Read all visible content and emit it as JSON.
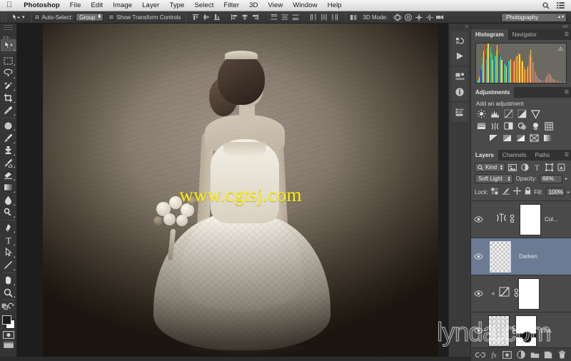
{
  "menubar": {
    "apple_icon": "apple-logo-icon",
    "items": [
      "Photoshop",
      "File",
      "Edit",
      "Image",
      "Layer",
      "Type",
      "Select",
      "Filter",
      "3D",
      "View",
      "Window",
      "Help"
    ],
    "right_icons": [
      "search-icon",
      "list-menu-icon"
    ]
  },
  "options_bar": {
    "tool_icon": "move-tool-icon",
    "auto_select_label": "Auto-Select:",
    "auto_select_value": "Group",
    "show_transform_label": "Show Transform Controls",
    "three_d_mode_label": "3D Mode:",
    "workspace_value": "Photography"
  },
  "toolbox": {
    "tools": [
      {
        "name": "move-tool",
        "selected": true
      },
      {
        "name": "rectangular-marquee-tool",
        "selected": false
      },
      {
        "name": "lasso-tool",
        "selected": false
      },
      {
        "name": "quick-selection-tool",
        "selected": false
      },
      {
        "name": "crop-tool",
        "selected": false
      },
      {
        "name": "eyedropper-tool",
        "selected": false
      },
      {
        "name": "spot-healing-brush-tool",
        "selected": false
      },
      {
        "name": "brush-tool",
        "selected": false
      },
      {
        "name": "clone-stamp-tool",
        "selected": false
      },
      {
        "name": "history-brush-tool",
        "selected": false
      },
      {
        "name": "eraser-tool",
        "selected": false
      },
      {
        "name": "gradient-tool",
        "selected": false
      },
      {
        "name": "blur-tool",
        "selected": false
      },
      {
        "name": "dodge-tool",
        "selected": false
      },
      {
        "name": "pen-tool",
        "selected": false
      },
      {
        "name": "horizontal-type-tool",
        "selected": false
      },
      {
        "name": "path-selection-tool",
        "selected": false
      },
      {
        "name": "line-shape-tool",
        "selected": false
      },
      {
        "name": "hand-tool",
        "selected": false
      },
      {
        "name": "zoom-tool",
        "selected": false
      }
    ],
    "foreground_color": "#1b1b1b",
    "background_color": "#ffffff",
    "quick_mask_name": "quick-mask-mode",
    "screen_mode_name": "screen-mode"
  },
  "canvas": {
    "watermark": "www.cgtsj.com",
    "watermark_color": "#ffee14",
    "image_description": "bride-portrait"
  },
  "mini_dock": {
    "buttons": [
      "history-panel-icon",
      "actions-play-icon",
      "properties-panel-icon",
      "info-panel-icon",
      "layer-comps-icon"
    ]
  },
  "panels": {
    "histogram": {
      "tabs": [
        {
          "label": "Histogram",
          "active": true
        },
        {
          "label": "Navigator",
          "active": false
        }
      ],
      "warning_icon": "cached-data-warning-icon",
      "bins": [
        3,
        5,
        8,
        14,
        22,
        31,
        46,
        62,
        78,
        92,
        70,
        55,
        84,
        96,
        74,
        61,
        88,
        72,
        55,
        40,
        52,
        66,
        79,
        93,
        88,
        70,
        58,
        64,
        56,
        49,
        53,
        47,
        44,
        40,
        44,
        49,
        52,
        55,
        58,
        56,
        53,
        50,
        54,
        58,
        62,
        66,
        71,
        75,
        70,
        64,
        58,
        52,
        46,
        40,
        34,
        29,
        33,
        41,
        55,
        68,
        80,
        74,
        62,
        50,
        38,
        30,
        24,
        18,
        14,
        11,
        9,
        7,
        6,
        5,
        5,
        6,
        8,
        11,
        16,
        22,
        28,
        24,
        19,
        15,
        12,
        10,
        8,
        7,
        6,
        5,
        4,
        4,
        3,
        3,
        2,
        2,
        2,
        1,
        1,
        1
      ]
    },
    "adjustments": {
      "tabs": [
        {
          "label": "Adjustments",
          "active": true
        }
      ],
      "title": "Add an adjustment",
      "row1": [
        "brightness-contrast-icon",
        "levels-icon",
        "curves-icon",
        "exposure-icon",
        "vibrance-icon"
      ],
      "row2": [
        "hue-saturation-icon",
        "color-balance-icon",
        "black-white-icon",
        "photo-filter-icon",
        "channel-mixer-icon",
        "color-lookup-icon"
      ],
      "row3": [
        "invert-icon",
        "posterize-icon",
        "threshold-icon",
        "selective-color-icon",
        "gradient-map-icon"
      ]
    },
    "layers": {
      "tabs": [
        {
          "label": "Layers",
          "active": true
        },
        {
          "label": "Channels",
          "active": false
        },
        {
          "label": "Paths",
          "active": false
        }
      ],
      "filter_kind_label": "Kind",
      "filter_icons": [
        "pixel-filter-icon",
        "adjustment-filter-icon",
        "type-filter-icon",
        "shape-filter-icon",
        "smart-object-filter-icon"
      ],
      "blend_mode": "Soft Light",
      "opacity_label": "Opacity:",
      "opacity_value": "66%",
      "lock_label": "Lock:",
      "lock_icons": [
        "lock-transparent-pixels-icon",
        "lock-image-pixels-icon",
        "lock-position-icon",
        "lock-all-icon"
      ],
      "fill_label": "Fill:",
      "fill_value": "100%",
      "rows": [
        {
          "name": "Col...",
          "visible": true,
          "active": false,
          "type": "adjustment",
          "thumb": "white",
          "has_link": true,
          "icons": [
            "color-balance-thumb-icon",
            "link-icon"
          ]
        },
        {
          "name": "Darken",
          "visible": true,
          "active": true,
          "type": "pixel",
          "thumb": "checker",
          "has_link": false,
          "icons": []
        },
        {
          "name": "",
          "visible": true,
          "active": false,
          "type": "adjustment",
          "thumb": "white",
          "has_link": true,
          "icons": [
            "curves-thumb-icon",
            "link-icon"
          ]
        },
        {
          "name": "Lisa.",
          "visible": true,
          "active": false,
          "type": "pixel",
          "thumb": "checker",
          "has_link": true,
          "icons": [
            "link-icon"
          ]
        }
      ],
      "footer_buttons": [
        "link-layers-icon",
        "layer-style-fx-icon",
        "add-layer-mask-icon",
        "new-adjustment-layer-icon",
        "new-group-icon",
        "new-layer-icon",
        "delete-layer-icon"
      ]
    }
  },
  "watermark_overlay": {
    "text": "lynda.com"
  }
}
